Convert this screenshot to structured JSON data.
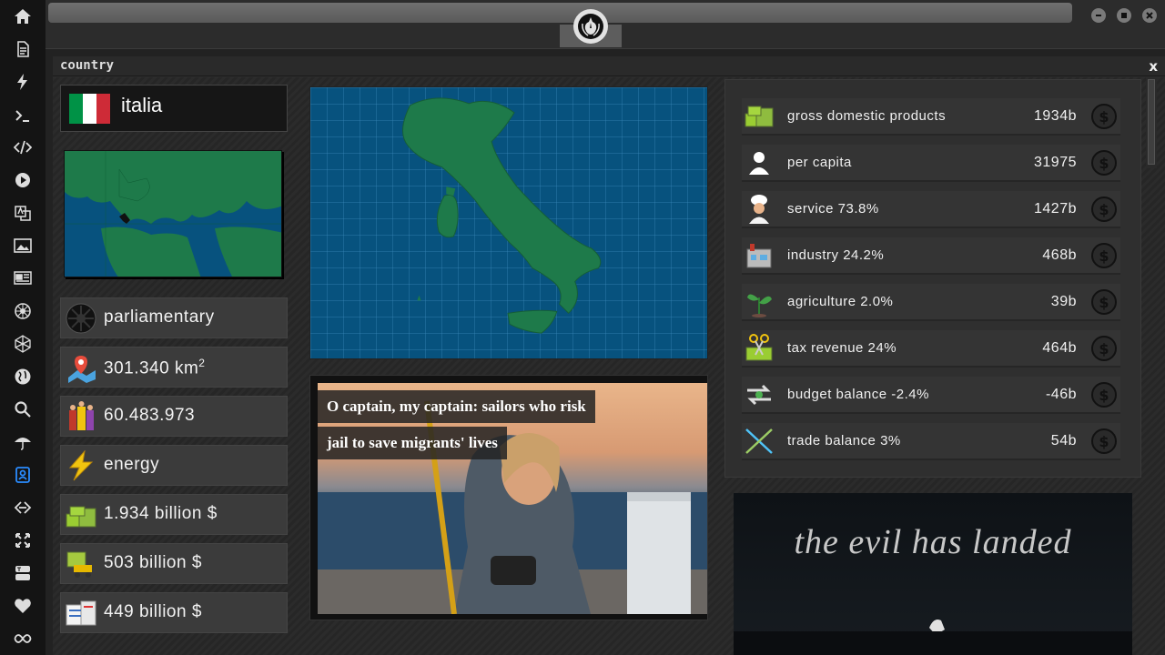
{
  "rail": {
    "icons": [
      "home-icon",
      "document-icon",
      "bolt-icon",
      "terminal-icon",
      "code-icon",
      "play-icon",
      "translate-icon",
      "image-icon",
      "news-icon",
      "rebel-icon",
      "network-icon",
      "globe-icon",
      "search-icon",
      "umbrella-icon",
      "contact-icon",
      "link-icon",
      "expand-icon",
      "youtube-icon",
      "heart-icon",
      "infinity-icon"
    ],
    "active": "contact-icon"
  },
  "panel": {
    "title": "country",
    "close": "x"
  },
  "country": {
    "name": "italia",
    "flag_colors": [
      "#009246",
      "#ffffff",
      "#ce2b37"
    ],
    "government": "parliamentary",
    "area_value": "301.340 km",
    "area_unit_exp": "2",
    "population": "60.483.973",
    "resource": "energy",
    "gdp_total": "1.934 billion $",
    "exports": "503 billion $",
    "imports": "449 billion $"
  },
  "economy": {
    "rows": [
      {
        "label": "gross domestic products",
        "value": "1934b",
        "icon": "money-stack-icon"
      },
      {
        "label": "per capita",
        "value": "31975",
        "icon": "person-icon"
      },
      {
        "label": "service 73.8%",
        "value": "1427b",
        "icon": "chef-icon"
      },
      {
        "label": "industry 24.2%",
        "value": "468b",
        "icon": "factory-icon"
      },
      {
        "label": "agriculture 2.0%",
        "value": "39b",
        "icon": "plant-icon"
      },
      {
        "label": "tax revenue 24%",
        "value": "464b",
        "icon": "tax-scissors-icon"
      },
      {
        "label": "budget balance -2.4%",
        "value": "-46b",
        "icon": "exchange-arrows-icon"
      },
      {
        "label": "trade balance 3%",
        "value": "54b",
        "icon": "trade-cross-icon"
      }
    ],
    "coin_symbol": "$"
  },
  "news": {
    "headline_line1": "O captain, my captain: sailors who risk",
    "headline_line2": "jail to save migrants' lives"
  },
  "ad": {
    "text": "the evil has landed"
  },
  "colors": {
    "sea": "#07527e",
    "land": "#1e7a4a",
    "accent": "#2a8cff"
  }
}
